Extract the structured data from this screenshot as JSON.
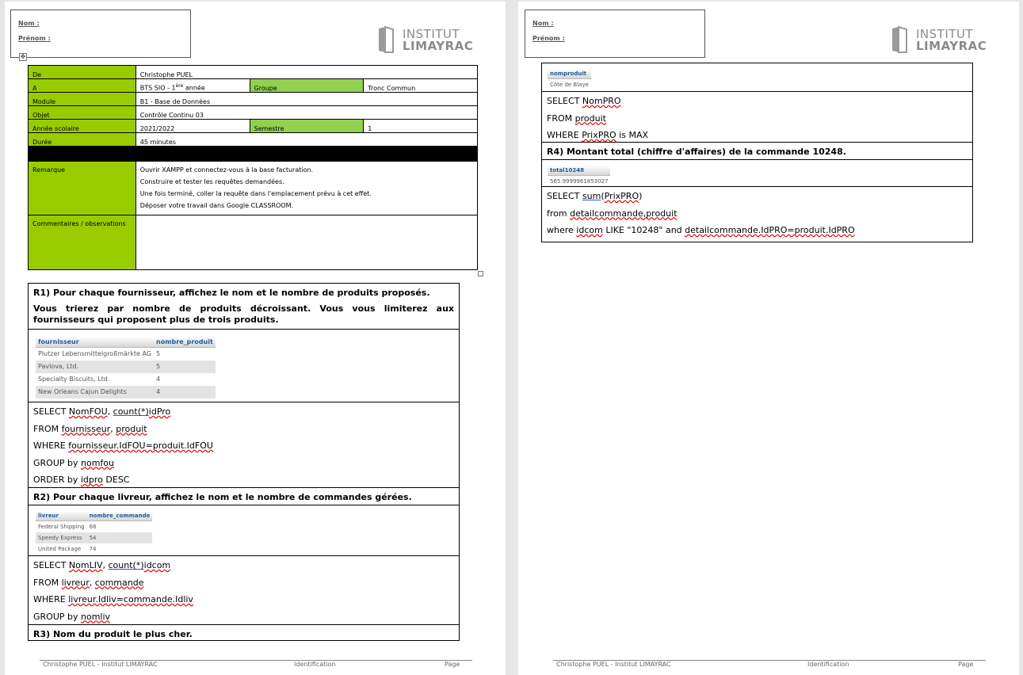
{
  "header": {
    "nom_label": "Nom :",
    "prenom_label": "Prénom :",
    "logo_line1": "INSTITUT",
    "logo_line2": "LIMAYRAC"
  },
  "info": {
    "de_label": "De",
    "de_value": "Christophe PUEL",
    "a_label": "A",
    "a_value_pre": "BTS SIO - 1",
    "a_value_sup": "ère",
    "a_value_post": " année",
    "groupe_label": "Groupe",
    "groupe_value": "Tronc Commun",
    "module_label": "Module",
    "module_value": "B1 - Base de Données",
    "objet_label": "Objet",
    "objet_value": "Contrôle Continu 03",
    "annee_label": "Année scolaire",
    "annee_value": "2021/2022",
    "semestre_label": "Semestre",
    "semestre_value": "1",
    "duree_label": "Durée",
    "duree_value": "45 minutes",
    "remarque_label": "Remarque",
    "remarques": [
      "Ouvrir XAMPP et connectez-vous à la base facturation.",
      "Construire et tester les requêtes demandées.",
      "Une fois terminé, coller la requête dans l'emplacement prévu à cet effet.",
      "Déposer votre travail dans Google CLASSROOM."
    ],
    "commentaires_label": "Commentaires / observations"
  },
  "r1": {
    "q1": "R1) Pour chaque fournisseur, affichez le nom et le nombre de produits proposés.",
    "q2": "Vous trierez par nombre de produits décroissant. Vous vous limiterez aux fournisseurs qui proposent plus de trois produits.",
    "columns": [
      "fournisseur",
      "nombre_produit"
    ],
    "rows": [
      [
        "Plutzer Lebensmittelgroßmärkte AG",
        "5"
      ],
      [
        "Pavlova, Ltd.",
        "5"
      ],
      [
        "Specialty Biscuits, Ltd.",
        "4"
      ],
      [
        "New Orleans Cajun Delights",
        "4"
      ]
    ],
    "sql": {
      "l1a": "SELECT ",
      "l1b": "NomFOU",
      "l1c": ", ",
      "l1d": "count",
      "l1e": "(*)",
      "l1f": "idPro",
      "l2a": "FROM ",
      "l2b": "fournisseur",
      "l2c": ", ",
      "l2d": "produit",
      "l3a": "WHERE ",
      "l3b": "fournisseur.IdFOU=produit.IdFOU",
      "l4a": "GROUP by ",
      "l4b": "nomfou",
      "l5a": "ORDER by ",
      "l5b": "idpro",
      "l5c": " DESC"
    }
  },
  "r2": {
    "q": "R2) Pour chaque livreur, affichez le nom et le nombre de commandes gérées.",
    "columns": [
      "livreur",
      "nombre_commande"
    ],
    "rows": [
      [
        "Federal Shipping",
        "68"
      ],
      [
        "Speedy Express",
        "54"
      ],
      [
        "United Package",
        "74"
      ]
    ],
    "sql": {
      "l1a": "SELECT ",
      "l1b": "NomLIV",
      "l1c": ", ",
      "l1d": "count",
      "l1e": "(*)",
      "l1f": "idcom",
      "l2a": "FROM ",
      "l2b": "livreur",
      "l2c": ", ",
      "l2d": "commande",
      "l3a": "WHERE ",
      "l3b": "livreur.Idliv=commande.Idliv",
      "l4a": "GROUP by ",
      "l4b": "nomliv"
    }
  },
  "r3": {
    "q": "R3) Nom du produit le plus cher.",
    "column": "nomproduit",
    "value": "Côte de Blaye",
    "sql": {
      "l1a": "SELECT ",
      "l1b": "NomPRO",
      "l2a": "FROM ",
      "l2b": "produit",
      "l3a": "WHERE ",
      "l3b": "PrixPRO",
      "l3c": " is MAX"
    }
  },
  "r4": {
    "q": "R4) Montant total (chiffre d'affaires) de la commande 10248.",
    "column": "total10248",
    "value": "565.9999961853027",
    "sql": {
      "l1a": "SELECT ",
      "l1b": "sum",
      "l1c": "(",
      "l1d": "PrixPRO",
      "l1e": ")",
      "l2a": "from ",
      "l2b": "detailcommande,produit",
      "l3a": "where ",
      "l3b": "idcom",
      "l3c": " LIKE \"10248\" and ",
      "l3d": "detailcommande.IdPRO=produit.IdPRO"
    }
  },
  "footer": {
    "author": "Christophe PUEL - Institut LIMAYRAC",
    "identification": "Identification",
    "page_label": "Page"
  }
}
